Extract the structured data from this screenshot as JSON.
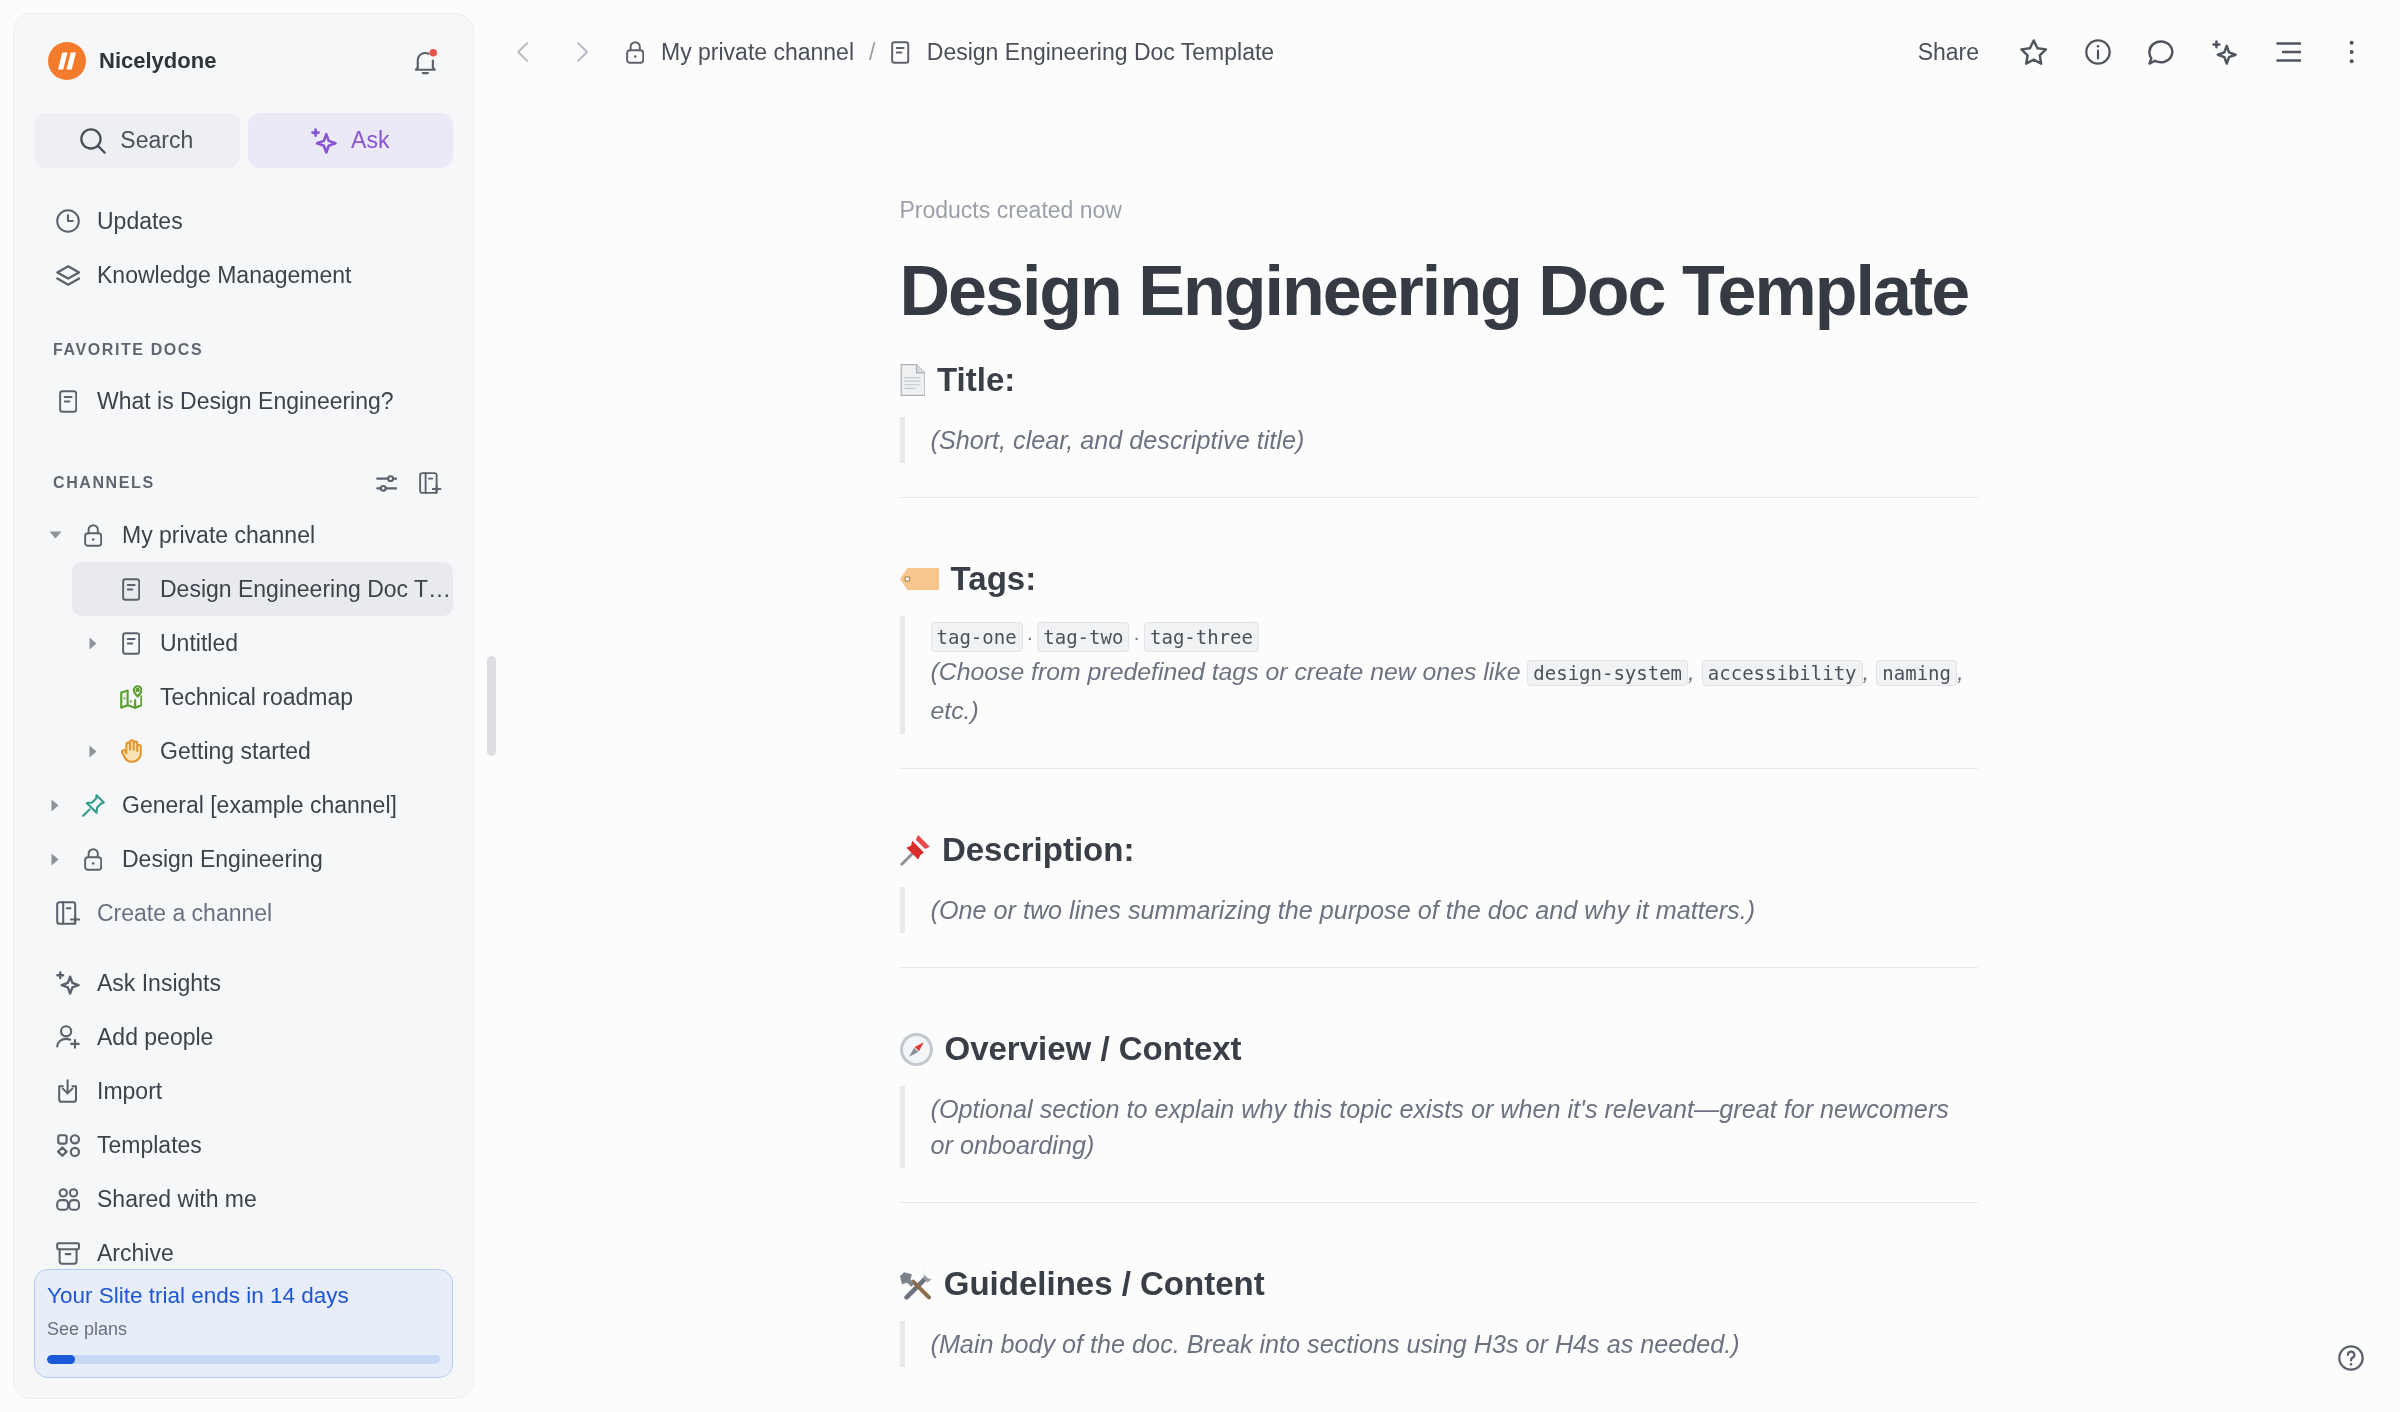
{
  "sidebar": {
    "workspace": {
      "name": "Nicelydone",
      "unread_notifications": true
    },
    "actions": [
      {
        "kind": "search",
        "label": "Search"
      },
      {
        "kind": "ask",
        "label": "Ask"
      }
    ],
    "nav": [
      {
        "label": "Updates"
      },
      {
        "label": "Knowledge Management"
      }
    ],
    "favorites": {
      "heading": "FAVORITE DOCS",
      "items": [
        {
          "label": "What is Design Engineering?"
        }
      ]
    },
    "channels": {
      "heading": "CHANNELS",
      "tree": [
        {
          "label": "My private channel",
          "expanded": true,
          "selected": false,
          "children": [
            {
              "label": "Design Engineering Doc T…",
              "selected": true
            },
            {
              "label": "Untitled",
              "expanded": false,
              "selected": false
            },
            {
              "label": "Technical roadmap",
              "selected": false
            },
            {
              "label": "Getting started",
              "expanded": false,
              "selected": false
            }
          ]
        },
        {
          "label": "General [example channel]",
          "expanded": false,
          "selected": false
        },
        {
          "label": "Design Engineering",
          "expanded": false,
          "selected": false
        }
      ],
      "create_label": "Create a channel"
    },
    "more_nav": [
      {
        "label": "Ask Insights"
      },
      {
        "label": "Add people"
      },
      {
        "label": "Import"
      },
      {
        "label": "Templates"
      },
      {
        "label": "Shared with me"
      },
      {
        "label": "Archive"
      }
    ],
    "trial": {
      "title": "Your Slite trial ends in 14 days",
      "link": "See plans",
      "level": 0.07
    }
  },
  "topbar": {
    "breadcrumb": [
      {
        "label": "My private channel"
      },
      {
        "label": "Design Engineering Doc Template"
      }
    ],
    "separator": "/",
    "share": "Share"
  },
  "doc": {
    "meta": "Products created now",
    "title": "Design Engineering Doc Template",
    "sections": [
      {
        "kind": "title",
        "heading": "Title:",
        "text": "(Short, clear, and descriptive title)"
      },
      {
        "kind": "tags",
        "heading": "Tags:",
        "tags": [
          {
            "code": "tag-one",
            "after": "·"
          },
          {
            "code": "tag-two",
            "after": "·"
          },
          {
            "code": "tag-three"
          }
        ],
        "hint": [
          {
            "kind": "text",
            "text": "(Choose from predefined tags or create new ones like "
          },
          {
            "kind": "code",
            "text": "design-system"
          },
          {
            "kind": "text",
            "text": ", "
          },
          {
            "kind": "code",
            "text": "accessibility"
          },
          {
            "kind": "text",
            "text": ", "
          },
          {
            "kind": "code",
            "text": "naming"
          },
          {
            "kind": "text",
            "text": ", etc.)"
          }
        ]
      },
      {
        "kind": "description",
        "heading": "Description:",
        "text": "(One or two lines summarizing the purpose of the doc and why it matters.)"
      },
      {
        "kind": "overview",
        "heading": "Overview / Context",
        "text": "(Optional section to explain why this topic exists or when it's relevant—great for newcomers or onboarding)"
      },
      {
        "kind": "guidelines",
        "heading": "Guidelines / Content",
        "text": "(Main body of the doc. Break into sections using H3s or H4s as needed.)"
      }
    ]
  }
}
